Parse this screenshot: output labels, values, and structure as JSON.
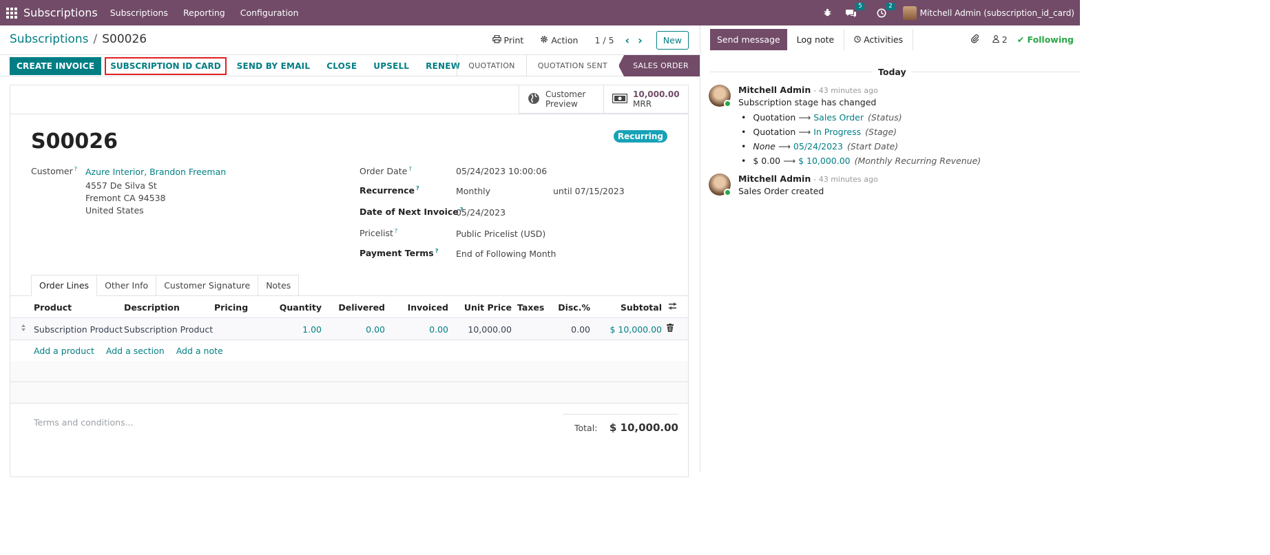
{
  "navbar": {
    "app_name": "Subscriptions",
    "menu": [
      "Subscriptions",
      "Reporting",
      "Configuration"
    ],
    "chat_count": "5",
    "activity_count": "2",
    "user": "Mitchell Admin (subscription_id_card)"
  },
  "control": {
    "breadcrumb_parent": "Subscriptions",
    "breadcrumb_sep": "/",
    "breadcrumb_current": "S00026",
    "print_label": "Print",
    "action_label": "Action",
    "pager": "1 / 5",
    "new_label": "New"
  },
  "statusbar": {
    "create_invoice": "CREATE INVOICE",
    "subscription_id_card": "SUBSCRIPTION ID CARD",
    "send_by_email": "SEND BY EMAIL",
    "close": "CLOSE",
    "upsell": "UPSELL",
    "renew": "RENEW",
    "stages": [
      "QUOTATION",
      "QUOTATION SENT",
      "SALES ORDER"
    ]
  },
  "smart_buttons": {
    "preview_line1": "Customer",
    "preview_line2": "Preview",
    "mrr_value": "10,000.00",
    "mrr_label": "MRR"
  },
  "form": {
    "badge": "Recurring",
    "title": "S00026",
    "customer_label": "Customer",
    "customer_name": "Azure Interior, Brandon Freeman",
    "address_line1": "4557 De Silva St",
    "address_line2": "Fremont CA 94538",
    "address_line3": "United States",
    "order_date_label": "Order Date",
    "order_date": "05/24/2023 10:00:06",
    "recurrence_label": "Recurrence",
    "recurrence": "Monthly",
    "until": "until 07/15/2023",
    "next_invoice_label": "Date of Next Invoice",
    "next_invoice": "05/24/2023",
    "pricelist_label": "Pricelist",
    "pricelist": "Public Pricelist (USD)",
    "payment_terms_label": "Payment Terms",
    "payment_terms": "End of Following Month",
    "help_mark": "?"
  },
  "tabs": [
    "Order Lines",
    "Other Info",
    "Customer Signature",
    "Notes"
  ],
  "table": {
    "headers": [
      "Product",
      "Description",
      "Pricing",
      "Quantity",
      "Delivered",
      "Invoiced",
      "Unit Price",
      "Taxes",
      "Disc.%",
      "Subtotal"
    ],
    "row": {
      "product": "Subscription Product",
      "description": "Subscription Product",
      "pricing": "",
      "quantity": "1.00",
      "delivered": "0.00",
      "invoiced": "0.00",
      "unit_price": "10,000.00",
      "taxes": "",
      "discount": "0.00",
      "subtotal": "$ 10,000.00"
    },
    "add_product": "Add a product",
    "add_section": "Add a section",
    "add_note": "Add a note"
  },
  "footer": {
    "terms_placeholder": "Terms and conditions...",
    "total_label": "Total:",
    "total_value": "$ 10,000.00"
  },
  "chatter": {
    "send_message": "Send message",
    "log_note": "Log note",
    "activities": "Activities",
    "followers_count": "2",
    "following": "Following",
    "today": "Today",
    "messages": [
      {
        "author": "Mitchell Admin",
        "time": "- 43 minutes ago",
        "text": "Subscription stage has changed",
        "changes": [
          {
            "old": "Quotation",
            "new": "Sales Order",
            "field": "(Status)"
          },
          {
            "old": "Quotation",
            "new": "In Progress",
            "field": "(Stage)"
          },
          {
            "old": "None",
            "new": "05/24/2023",
            "field": "(Start Date)"
          },
          {
            "old": "$ 0.00",
            "new": "$ 10,000.00",
            "field": "(Monthly Recurring Revenue)"
          }
        ]
      },
      {
        "author": "Mitchell Admin",
        "time": "- 43 minutes ago",
        "text": "Sales Order created"
      }
    ]
  }
}
